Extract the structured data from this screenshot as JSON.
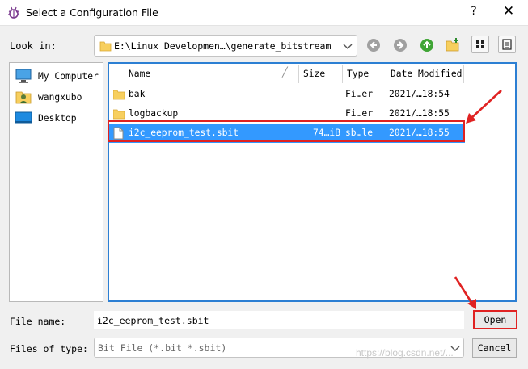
{
  "window": {
    "title": "Select a Configuration File",
    "help_glyph": "?",
    "close_glyph": "✕"
  },
  "toolbar": {
    "look_in_label": "Look in:",
    "path": "E:\\Linux Developmen…\\generate_bitstream"
  },
  "places": [
    {
      "label": "My Computer",
      "icon": "computer-icon"
    },
    {
      "label": "wangxubo",
      "icon": "user-folder-icon"
    },
    {
      "label": "Desktop",
      "icon": "desktop-icon"
    }
  ],
  "columns": {
    "name": "Name",
    "size": "Size",
    "type": "Type",
    "modified": "Date Modified"
  },
  "files": [
    {
      "name": "bak",
      "size": "",
      "type": "Fi…er",
      "modified": "2021/…18:54",
      "icon": "folder-icon",
      "selected": false
    },
    {
      "name": "logbackup",
      "size": "",
      "type": "Fi…er",
      "modified": "2021/…18:55",
      "icon": "folder-icon",
      "selected": false
    },
    {
      "name": "i2c_eeprom_test.sbit",
      "size": "74…iB",
      "type": "sb…le",
      "modified": "2021/…18:55",
      "icon": "file-icon",
      "selected": true
    }
  ],
  "form": {
    "file_name_label": "File name:",
    "file_name_value": "i2c_eeprom_test.sbit",
    "file_type_label": "Files of type:",
    "file_type_value": "Bit File (*.bit *.sbit)"
  },
  "buttons": {
    "open": "Open",
    "cancel": "Cancel"
  },
  "watermark": "https://blog.csdn.net/...",
  "colors": {
    "selection": "#3399ff",
    "highlight_outline": "#e02222",
    "list_border": "#2c7fd3"
  }
}
